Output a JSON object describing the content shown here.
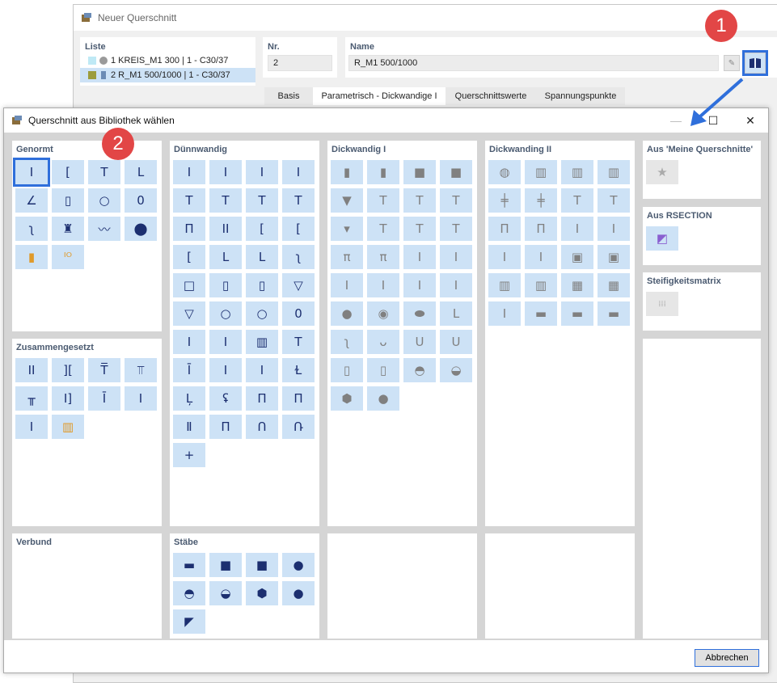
{
  "background_window": {
    "title": "Neuer Querschnitt",
    "list_header": "Liste",
    "list_items": [
      {
        "label": "1  KREIS_M1 300 | 1 - C30/37",
        "color": "#bfe9f5",
        "shape": "circle"
      },
      {
        "label": "2  R_M1 500/1000 | 1 - C30/37",
        "color": "#9c9c3c",
        "shape": "rect"
      }
    ],
    "nr_label": "Nr.",
    "nr_value": "2",
    "name_label": "Name",
    "name_value": "R_M1 500/1000",
    "tabs": [
      "Basis",
      "Parametrisch - Dickwandige I",
      "Querschnittswerte",
      "Spannungspunkte"
    ],
    "active_tab": "Parametrisch - Dickwandige I"
  },
  "badges": [
    "1",
    "2"
  ],
  "dialog": {
    "title": "Querschnitt aus Bibliothek wählen",
    "minimize": "—",
    "maximize": "☐",
    "close": "✕",
    "cancel_label": "Abbrechen",
    "groups": {
      "genormt": {
        "title": "Genormt",
        "icons": [
          "I",
          "[",
          "T",
          "L",
          "∠",
          "▯",
          "○",
          "0",
          "ʅ",
          "♜",
          "〰",
          "⬤",
          "▮",
          "ᴵᴼ"
        ]
      },
      "zusammengesetzt": {
        "title": "Zusammengesetzt",
        "icons": [
          "II",
          "][",
          "T̅",
          "⫪",
          "╥",
          "I]",
          "Ī",
          "I",
          "I",
          "▥"
        ]
      },
      "verbund": {
        "title": "Verbund"
      },
      "duennwandig": {
        "title": "Dünnwandig",
        "icons": [
          "I",
          "I",
          "I",
          "I",
          "T",
          "T",
          "T",
          "T",
          "Π",
          "II",
          "[",
          "[",
          "[",
          "L",
          "L",
          "ʅ",
          "□",
          "▯",
          "▯",
          "▽",
          "▽",
          "○",
          "○",
          "0",
          "I",
          "I",
          "▥",
          "T",
          "Ī",
          "I",
          "I",
          "Ɫ",
          "Ļ",
          "ʢ",
          "Π",
          "Π",
          "Ⅱ",
          "Π",
          "Ո",
          "Ռ",
          "+"
        ]
      },
      "staebe": {
        "title": "Stäbe",
        "icons": [
          "▬",
          "■",
          "■",
          "●",
          "◓",
          "◒",
          "⬢",
          "●",
          "◤"
        ]
      },
      "dickwandig1": {
        "title": "Dickwandig I",
        "icons": [
          "▮",
          "▮",
          "■",
          "■",
          "▼",
          "T",
          "T",
          "T",
          "▾",
          "T",
          "T",
          "T",
          "π",
          "π",
          "I",
          "I",
          "I",
          "I",
          "I",
          "I",
          "●",
          "◉",
          "⬬",
          "L",
          "ʅ",
          "ᴗ",
          "U",
          "U",
          "▯",
          "▯",
          "◓",
          "◒",
          "⬢",
          "●"
        ]
      },
      "dickwandig2": {
        "title": "Dickwanding II",
        "icons": [
          "◍",
          "▥",
          "▥",
          "▥",
          "╪",
          "╪",
          "T",
          "T",
          "Π",
          "Π",
          "I",
          "I",
          "I",
          "I",
          "▣",
          "▣",
          "▥",
          "▥",
          "▦",
          "▦",
          "I",
          "▬",
          "▬",
          "▬"
        ]
      },
      "meine": {
        "title": "Aus 'Meine Querschnitte'",
        "icon": "★"
      },
      "rsection": {
        "title": "Aus RSECTION",
        "icon": "◩"
      },
      "steifigkeit": {
        "title": "Steifigkeitsmatrix",
        "icon": "⁞⁞⁞"
      }
    }
  }
}
